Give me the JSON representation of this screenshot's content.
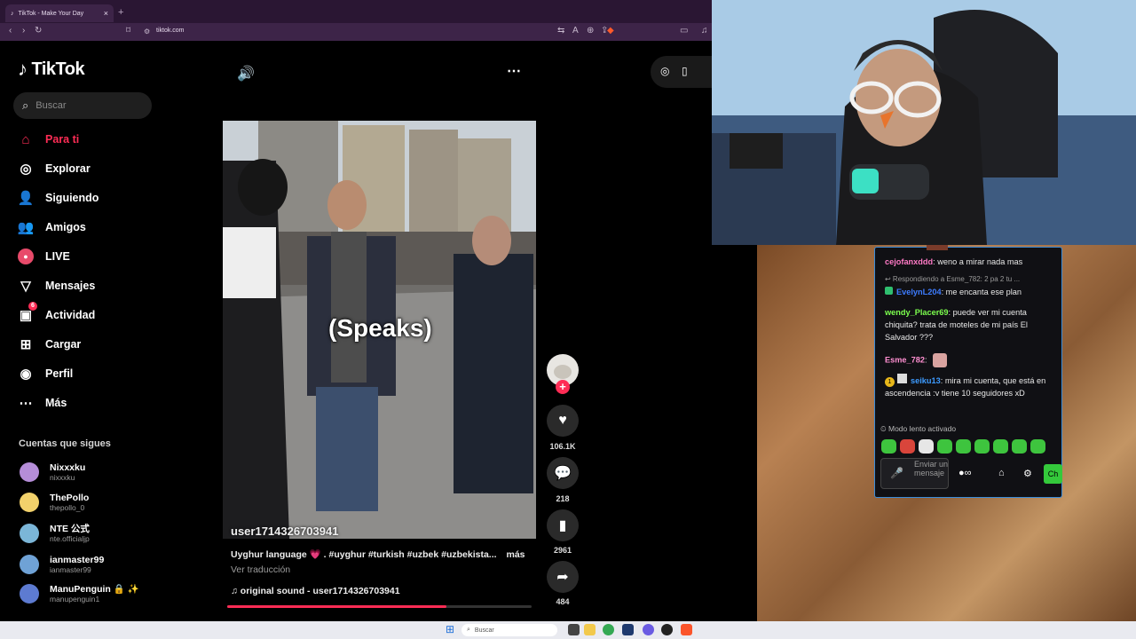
{
  "browser": {
    "tab_title": "TikTok - Make Your Day",
    "tab_close": "×",
    "new_tab": "+",
    "url": "tiktok.com"
  },
  "tiktok": {
    "logo_text": "TikTok",
    "search_placeholder": "Buscar",
    "nav": [
      {
        "label": "Para ti",
        "icon": "home-icon",
        "glyph": "⌂",
        "active": true
      },
      {
        "label": "Explorar",
        "icon": "compass-icon",
        "glyph": "◎"
      },
      {
        "label": "Siguiendo",
        "icon": "following-icon",
        "glyph": "👤"
      },
      {
        "label": "Amigos",
        "icon": "friends-icon",
        "glyph": "👥"
      },
      {
        "label": "LIVE",
        "icon": "live-avatar-icon",
        "glyph": "●"
      },
      {
        "label": "Mensajes",
        "icon": "messages-icon",
        "glyph": "▽"
      },
      {
        "label": "Actividad",
        "icon": "activity-icon",
        "glyph": "▣",
        "badge": "6"
      },
      {
        "label": "Cargar",
        "icon": "upload-icon",
        "glyph": "⊞"
      },
      {
        "label": "Perfil",
        "icon": "profile-icon",
        "glyph": "◉"
      },
      {
        "label": "Más",
        "icon": "more-icon",
        "glyph": "⋯"
      }
    ],
    "following_title": "Cuentas que sigues",
    "following": [
      {
        "name": "Nixxxku",
        "handle": "nixxxku",
        "color": "#b58dd8"
      },
      {
        "name": "ThePollo",
        "handle": "thepollo_0",
        "color": "#f2d16b"
      },
      {
        "name": "NTE 公式",
        "handle": "nte.officialjp",
        "color": "#7bb6d8"
      },
      {
        "name": "ianmaster99",
        "handle": "ianmaster99",
        "color": "#6fa2d6"
      },
      {
        "name": "ManuPenguin 🔒 ✨",
        "handle": "manupenguin1",
        "color": "#5d7bd1"
      }
    ],
    "video": {
      "caption_overlay": "(Speaks)",
      "username_overlay": "user1714326703941",
      "description": "Uyghur language 💗 . #uyghur #turkish #uzbek #uzbekista...",
      "more": "más",
      "translate": "Ver traducción",
      "sound": "♫  original sound - user1714326703941",
      "progress": 0.72
    },
    "actions": {
      "likes": "106.1K",
      "comments": "218",
      "saves": "2961",
      "shares": "484"
    }
  },
  "chat": {
    "messages": [
      {
        "user": "cejofanxddd",
        "color": "#ff7ac6",
        "text": ": weno a mirar nada mas"
      },
      {
        "reply_note": "↩ Respondiendo a Esme_782: 2 pa 2 tu ..."
      },
      {
        "user": "EvelynL204",
        "color": "#3d7cff",
        "text": ": me encanta ese plan"
      },
      {
        "user": "wendy_Placer69",
        "color": "#7cff4e",
        "text": ": puede ver mi cuenta chiquita? trata de moteles de mi país El Salvador ???"
      },
      {
        "user": "Esme_782",
        "color": "#ff8fd1",
        "text": ":"
      },
      {
        "user": "seiku13",
        "color": "#3d9bff",
        "text": ": mira mi cuenta, que está en ascendencia :v tiene 10 seguidores xD"
      }
    ],
    "slow_mode": "⏲ Modo lento activado",
    "input_placeholder": "Enviar un mensaje",
    "send_label": "Ch"
  },
  "taskbar": {
    "search_placeholder": "Buscar"
  }
}
